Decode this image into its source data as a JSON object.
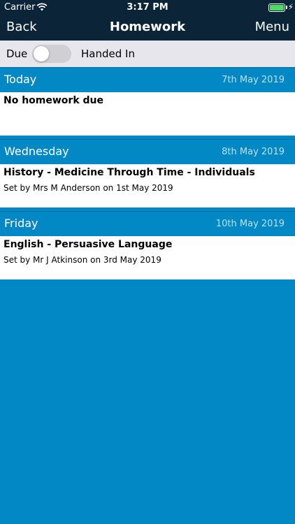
{
  "status_bar": {
    "carrier": "Carrier",
    "time": "3:17 PM",
    "wifi_icon": "wifi-icon",
    "battery_icon": "battery-icon",
    "charging_icon": "bolt-icon",
    "battery_level": 1.0
  },
  "nav": {
    "back_label": "Back",
    "title": "Homework",
    "menu_label": "Menu"
  },
  "filter": {
    "due_label": "Due",
    "handed_in_label": "Handed In",
    "handed_in_on": false
  },
  "sections": [
    {
      "day": "Today",
      "date": "7th May 2019",
      "title": "No homework due",
      "subtitle": ""
    },
    {
      "day": "Wednesday",
      "date": "8th May 2019",
      "title": "History - Medicine Through Time - Individuals",
      "subtitle": "Set by Mrs M Anderson on 1st May 2019"
    },
    {
      "day": "Friday",
      "date": "10th May 2019",
      "title": "English - Persuasive Language",
      "subtitle": "Set by Mr J Atkinson on 3rd May 2019"
    }
  ],
  "colors": {
    "nav_bg": "#0b2438",
    "section_header": "#0388c6",
    "battery": "#4cd964"
  }
}
